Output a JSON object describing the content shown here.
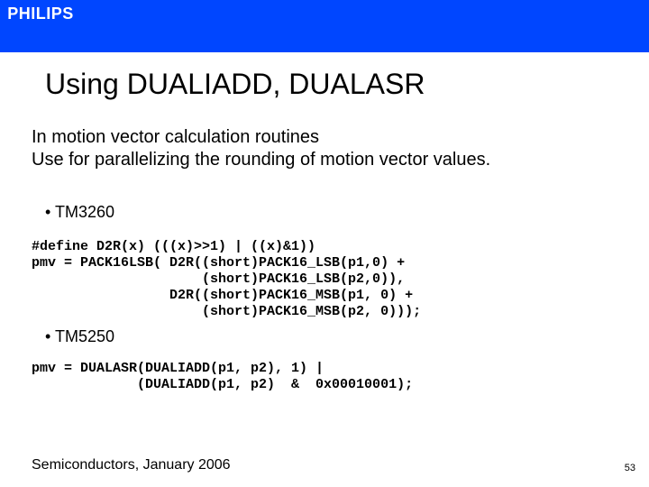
{
  "header": {
    "brand": "PHILIPS"
  },
  "slide": {
    "title": "Using DUALIADD, DUALASR",
    "intro_line1": "In motion vector calculation routines",
    "intro_line2": "Use for parallelizing the rounding of motion vector values."
  },
  "sections": [
    {
      "bullet": "•   TM3260",
      "code": "#define D2R(x) (((x)>>1) | ((x)&1))\npmv = PACK16LSB( D2R((short)PACK16_LSB(p1,0) +\n                     (short)PACK16_LSB(p2,0)),\n                 D2R((short)PACK16_MSB(p1, 0) +\n                     (short)PACK16_MSB(p2, 0)));"
    },
    {
      "bullet": "•    TM5250",
      "code": "pmv = DUALASR(DUALIADD(p1, p2), 1) |\n             (DUALIADD(p1, p2)  &  0x00010001);"
    }
  ],
  "footer": {
    "left": "Semiconductors, January 2006",
    "page": "53"
  }
}
